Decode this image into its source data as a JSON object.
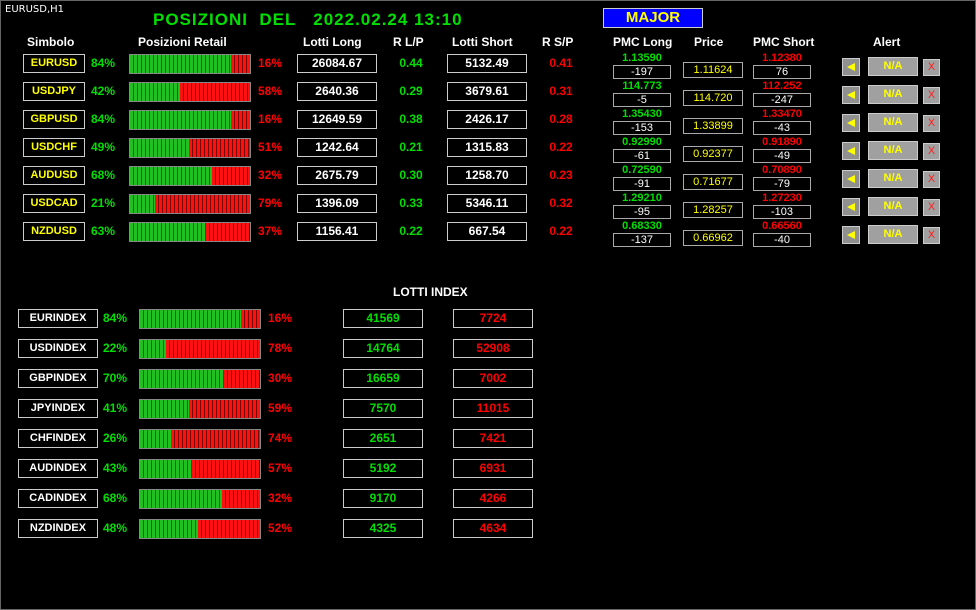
{
  "chart_label": "EURUSD,H1",
  "title": "POSIZIONI  DEL   2022.02.24 13:10",
  "major_button": "MAJOR",
  "headers": {
    "simbolo": "Simbolo",
    "posizioni_retail": "Posizioni Retail",
    "lotti_long": "Lotti Long",
    "r_lp": "R L/P",
    "lotti_short": "Lotti Short",
    "r_sp": "R S/P",
    "pmc_long": "PMC Long",
    "price": "Price",
    "pmc_short": "PMC Short",
    "alert": "Alert"
  },
  "pairs": [
    {
      "symbol": "EURUSD",
      "long_pct": "84%",
      "short_pct": "16%",
      "long_fraction": 0.84,
      "lotti_long": "26084.67",
      "r_lp": "0.44",
      "lotti_short": "5132.49",
      "r_sp": "0.41",
      "pmc_long": "1.13590",
      "pmc_long_diff": "-197",
      "price": "1.11624",
      "pmc_short": "1.12380",
      "pmc_short_diff": "76",
      "alert": "N/A",
      "close": "X"
    },
    {
      "symbol": "USDJPY",
      "long_pct": "42%",
      "short_pct": "58%",
      "long_fraction": 0.42,
      "lotti_long": "2640.36",
      "r_lp": "0.29",
      "lotti_short": "3679.61",
      "r_sp": "0.31",
      "pmc_long": "114.773",
      "pmc_long_diff": "-5",
      "price": "114.720",
      "pmc_short": "112.252",
      "pmc_short_diff": "-247",
      "alert": "N/A",
      "close": "X"
    },
    {
      "symbol": "GBPUSD",
      "long_pct": "84%",
      "short_pct": "16%",
      "long_fraction": 0.84,
      "lotti_long": "12649.59",
      "r_lp": "0.38",
      "lotti_short": "2426.17",
      "r_sp": "0.28",
      "pmc_long": "1.35430",
      "pmc_long_diff": "-153",
      "price": "1.33899",
      "pmc_short": "1.33470",
      "pmc_short_diff": "-43",
      "alert": "N/A",
      "close": "X"
    },
    {
      "symbol": "USDCHF",
      "long_pct": "49%",
      "short_pct": "51%",
      "long_fraction": 0.49,
      "lotti_long": "1242.64",
      "r_lp": "0.21",
      "lotti_short": "1315.83",
      "r_sp": "0.22",
      "pmc_long": "0.92990",
      "pmc_long_diff": "-61",
      "price": "0.92377",
      "pmc_short": "0.91890",
      "pmc_short_diff": "-49",
      "alert": "N/A",
      "close": "X"
    },
    {
      "symbol": "AUDUSD",
      "long_pct": "68%",
      "short_pct": "32%",
      "long_fraction": 0.68,
      "lotti_long": "2675.79",
      "r_lp": "0.30",
      "lotti_short": "1258.70",
      "r_sp": "0.23",
      "pmc_long": "0.72590",
      "pmc_long_diff": "-91",
      "price": "0.71677",
      "pmc_short": "0.70890",
      "pmc_short_diff": "-79",
      "alert": "N/A",
      "close": "X"
    },
    {
      "symbol": "USDCAD",
      "long_pct": "21%",
      "short_pct": "79%",
      "long_fraction": 0.21,
      "lotti_long": "1396.09",
      "r_lp": "0.33",
      "lotti_short": "5346.11",
      "r_sp": "0.32",
      "pmc_long": "1.29210",
      "pmc_long_diff": "-95",
      "price": "1.28257",
      "pmc_short": "1.27230",
      "pmc_short_diff": "-103",
      "alert": "N/A",
      "close": "X"
    },
    {
      "symbol": "NZDUSD",
      "long_pct": "63%",
      "short_pct": "37%",
      "long_fraction": 0.63,
      "lotti_long": "1156.41",
      "r_lp": "0.22",
      "lotti_short": "667.54",
      "r_sp": "0.22",
      "pmc_long": "0.68330",
      "pmc_long_diff": "-137",
      "price": "0.66962",
      "pmc_short": "0.66560",
      "pmc_short_diff": "-40",
      "alert": "N/A",
      "close": "X"
    }
  ],
  "lotti_index_title": "LOTTI INDEX",
  "indexes": [
    {
      "symbol": "EURINDEX",
      "long_pct": "84%",
      "short_pct": "16%",
      "long_fraction": 0.84,
      "long": "41569",
      "short": "7724"
    },
    {
      "symbol": "USDINDEX",
      "long_pct": "22%",
      "short_pct": "78%",
      "long_fraction": 0.22,
      "long": "14764",
      "short": "52908"
    },
    {
      "symbol": "GBPINDEX",
      "long_pct": "70%",
      "short_pct": "30%",
      "long_fraction": 0.7,
      "long": "16659",
      "short": "7002"
    },
    {
      "symbol": "JPYINDEX",
      "long_pct": "41%",
      "short_pct": "59%",
      "long_fraction": 0.41,
      "long": "7570",
      "short": "11015"
    },
    {
      "symbol": "CHFINDEX",
      "long_pct": "26%",
      "short_pct": "74%",
      "long_fraction": 0.26,
      "long": "2651",
      "short": "7421"
    },
    {
      "symbol": "AUDINDEX",
      "long_pct": "43%",
      "short_pct": "57%",
      "long_fraction": 0.43,
      "long": "5192",
      "short": "6931"
    },
    {
      "symbol": "CADINDEX",
      "long_pct": "68%",
      "short_pct": "32%",
      "long_fraction": 0.68,
      "long": "9170",
      "short": "4266"
    },
    {
      "symbol": "NZDINDEX",
      "long_pct": "48%",
      "short_pct": "52%",
      "long_fraction": 0.48,
      "long": "4325",
      "short": "4634"
    }
  ],
  "colors": {
    "long": "#00e000",
    "short": "#ff0000",
    "symbol": "#ffff00",
    "price": "#ffff00",
    "major_bg": "#0000ff"
  }
}
